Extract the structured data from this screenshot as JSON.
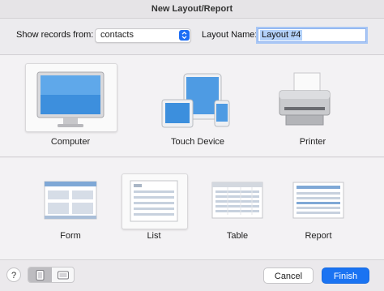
{
  "window": {
    "title": "New Layout/Report"
  },
  "toolbar": {
    "show_records_label": "Show records from:",
    "show_records_value": "contacts",
    "layout_name_label": "Layout Name:",
    "layout_name_value": "Layout #4"
  },
  "devices": [
    {
      "label": "Computer",
      "icon": "computer-icon",
      "selected": true
    },
    {
      "label": "Touch Device",
      "icon": "touch-device-icon",
      "selected": false
    },
    {
      "label": "Printer",
      "icon": "printer-icon",
      "selected": false
    }
  ],
  "layout_types": [
    {
      "label": "Form",
      "icon": "form-icon",
      "selected": false
    },
    {
      "label": "List",
      "icon": "list-icon",
      "selected": true
    },
    {
      "label": "Table",
      "icon": "table-icon",
      "selected": false
    },
    {
      "label": "Report",
      "icon": "report-icon",
      "selected": false
    }
  ],
  "footer": {
    "help_label": "?",
    "cancel_label": "Cancel",
    "finish_label": "Finish"
  },
  "colors": {
    "accent": "#1a73f2",
    "background": "#ebe9ec",
    "panel": "#f3f2f4"
  }
}
